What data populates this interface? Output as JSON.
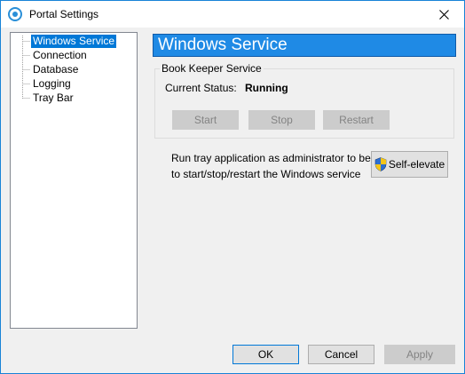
{
  "window": {
    "title": "Portal Settings",
    "close_glyph": "✕"
  },
  "tree": {
    "items": [
      {
        "label": "Windows Service",
        "selected": true
      },
      {
        "label": "Connection"
      },
      {
        "label": "Database"
      },
      {
        "label": "Logging"
      },
      {
        "label": "Tray Bar"
      }
    ]
  },
  "panel": {
    "header": "Windows Service",
    "group": {
      "title": "Book Keeper Service",
      "status_label": "Current Status:",
      "status_value": "Running",
      "buttons": {
        "start": "Start",
        "stop": "Stop",
        "restart": "Restart"
      }
    },
    "elevate": {
      "line1": "Run tray application as administrator to be able",
      "line2": "to start/stop/restart the Windows service",
      "button": "Self-elevate"
    }
  },
  "footer": {
    "ok": "OK",
    "cancel": "Cancel",
    "apply": "Apply"
  },
  "colors": {
    "accent": "#0078d7",
    "header_bg": "#1f8ae5",
    "window_border": "#1883d7"
  },
  "icons": {
    "app": "portal-logo-icon",
    "elevate": "uac-shield-icon",
    "close": "close-icon"
  }
}
